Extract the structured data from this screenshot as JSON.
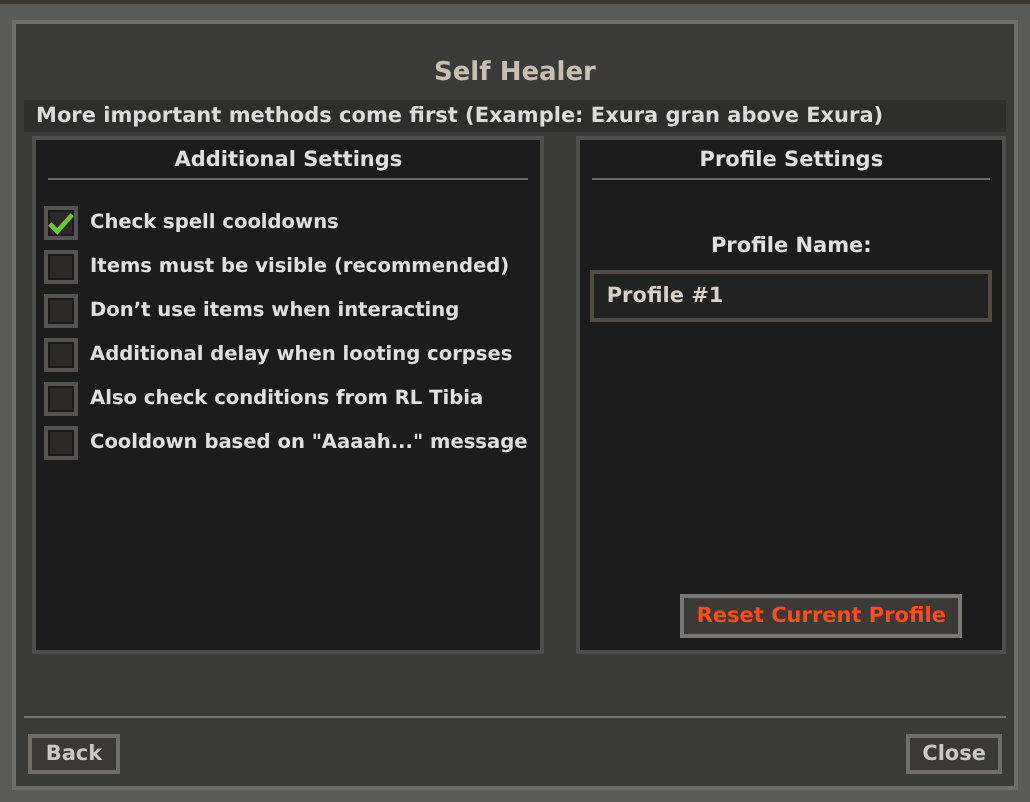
{
  "window": {
    "title": "Self Healer"
  },
  "hint": "More important methods come first (Example: Exura gran above Exura)",
  "additional_settings": {
    "title": "Additional Settings",
    "options": [
      {
        "label": "Check spell cooldowns",
        "checked": true
      },
      {
        "label": "Items must be visible (recommended)",
        "checked": false
      },
      {
        "label": "Don’t use items when interacting",
        "checked": false
      },
      {
        "label": "Additional delay when looting corpses",
        "checked": false
      },
      {
        "label": "Also check conditions from RL Tibia",
        "checked": false
      },
      {
        "label": "Cooldown based on \"Aaaah...\" message",
        "checked": false
      }
    ]
  },
  "profile_settings": {
    "title": "Profile Settings",
    "name_label": "Profile Name:",
    "name_value": "Profile #1",
    "reset_button": "Reset Current Profile"
  },
  "buttons": {
    "back": "Back",
    "close": "Close"
  }
}
